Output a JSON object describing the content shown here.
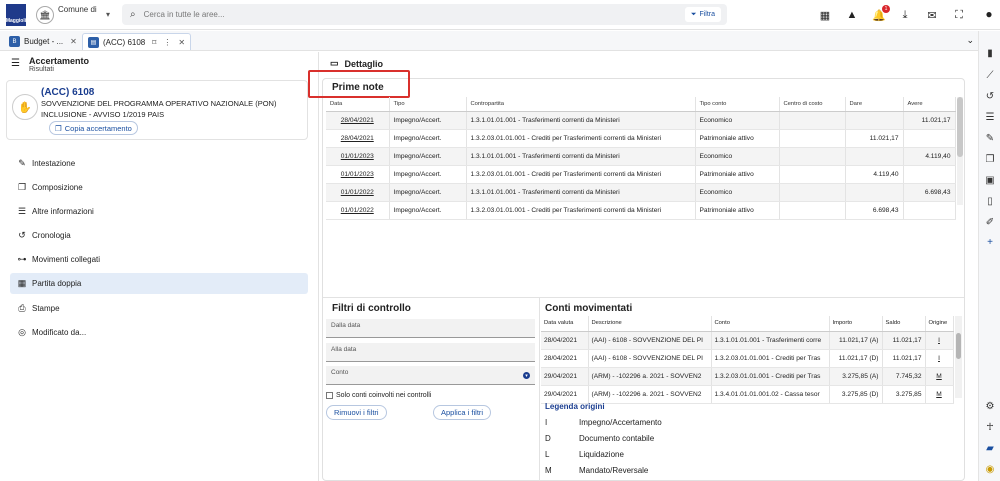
{
  "topbar": {
    "logo_text": "Maggioli",
    "ente_label": "Comune di",
    "search_placeholder": "Cerca in tutte le aree...",
    "filter_label": "Filtra",
    "notification_count": "1"
  },
  "tabs": [
    {
      "label": "Budget - ...",
      "icon": "budget-icon"
    },
    {
      "label": "(ACC) 6108",
      "icon": "document-icon"
    }
  ],
  "left": {
    "header_title": "Accertamento",
    "header_subtitle": "Risultati",
    "card": {
      "code": "(ACC) 6108",
      "line1": "SOVVENZIONE DEL PROGRAMMA OPERATIVO NAZIONALE (PON)",
      "line2": "INCLUSIONE - AVVISO 1/2019 PAIS",
      "copy_button": "Copia accertamento"
    },
    "nav": [
      {
        "label": "Intestazione",
        "icon": "pencil-icon"
      },
      {
        "label": "Composizione",
        "icon": "layers-icon"
      },
      {
        "label": "Altre informazioni",
        "icon": "list-icon"
      },
      {
        "label": "Cronologia",
        "icon": "history-icon"
      },
      {
        "label": "Movimenti collegati",
        "icon": "link-icon"
      },
      {
        "label": "Partita doppia",
        "icon": "table-icon",
        "selected": true
      },
      {
        "label": "Stampe",
        "icon": "printer-icon"
      },
      {
        "label": "Modificato da...",
        "icon": "fingerprint-icon"
      }
    ]
  },
  "detail": {
    "header": "Dettaglio",
    "prime_note": {
      "title": "Prime note",
      "columns": [
        "Data",
        "Tipo",
        "Contropartita",
        "Tipo conto",
        "Centro di costo",
        "Dare",
        "Avere"
      ],
      "rows": [
        [
          "28/04/2021",
          "Impegno/Accert.",
          "1.3.1.01.01.001 - Trasferimenti correnti da Ministeri",
          "Economico",
          "",
          "",
          "11.021,17"
        ],
        [
          "28/04/2021",
          "Impegno/Accert.",
          "1.3.2.03.01.01.001 - Crediti per Trasferimenti correnti da Ministeri",
          "Patrimoniale attivo",
          "",
          "11.021,17",
          ""
        ],
        [
          "01/01/2023",
          "Impegno/Accert.",
          "1.3.1.01.01.001 - Trasferimenti correnti da Ministeri",
          "Economico",
          "",
          "",
          "4.119,40"
        ],
        [
          "01/01/2023",
          "Impegno/Accert.",
          "1.3.2.03.01.01.001 - Crediti per Trasferimenti correnti da Ministeri",
          "Patrimoniale attivo",
          "",
          "4.119,40",
          ""
        ],
        [
          "01/01/2022",
          "Impegno/Accert.",
          "1.3.1.01.01.001 - Trasferimenti correnti da Ministeri",
          "Economico",
          "",
          "",
          "6.698,43"
        ],
        [
          "01/01/2022",
          "Impegno/Accert.",
          "1.3.2.03.01.01.001 - Crediti per Trasferimenti correnti da Ministeri",
          "Patrimoniale attivo",
          "",
          "6.698,43",
          ""
        ]
      ]
    },
    "filters": {
      "title": "Filtri di controllo",
      "from_placeholder": "Dalla data",
      "to_placeholder": "Alla data",
      "account_placeholder": "Conto",
      "checkbox_label": "Solo conti coinvolti nei controlli",
      "remove_button": "Rimuovi i filtri",
      "apply_button": "Applica i filtri"
    },
    "conti": {
      "title": "Conti movimentati",
      "columns": [
        "Data valuta",
        "Descrizione",
        "Conto",
        "Importo",
        "Saldo",
        "Origine"
      ],
      "rows": [
        [
          "28/04/2021",
          "(AAI) - 6108 - SOVVENZIONE DEL PI",
          "1.3.1.01.01.001 - Trasferimenti corre",
          "11.021,17 (A)",
          "11.021,17",
          "I"
        ],
        [
          "28/04/2021",
          "(AAI) - 6108 - SOVVENZIONE DEL PI",
          "1.3.2.03.01.01.001 - Crediti per Tras",
          "11.021,17 (D)",
          "11.021,17",
          "I"
        ],
        [
          "29/04/2021",
          "(ARM) - -102296 a. 2021 - SOVVEN2",
          "1.3.2.03.01.01.001 - Crediti per Tras",
          "3.275,85 (A)",
          "7.745,32",
          "M"
        ],
        [
          "29/04/2021",
          "(ARM) - -102296 a. 2021 - SOVVEN2",
          "1.3.4.01.01.01.001.02 - Cassa tesor",
          "3.275,85 (D)",
          "3.275,85",
          "M"
        ]
      ]
    },
    "legend": {
      "title": "Legenda origini",
      "items": [
        {
          "key": "I",
          "label": "Impegno/Accertamento"
        },
        {
          "key": "D",
          "label": "Documento contabile"
        },
        {
          "key": "L",
          "label": "Liquidazione"
        },
        {
          "key": "M",
          "label": "Mandato/Reversale"
        }
      ]
    }
  },
  "colors": {
    "accent": "#1a3d8f",
    "highlight": "#d9302c",
    "selected_bg": "#e3ecf8"
  }
}
